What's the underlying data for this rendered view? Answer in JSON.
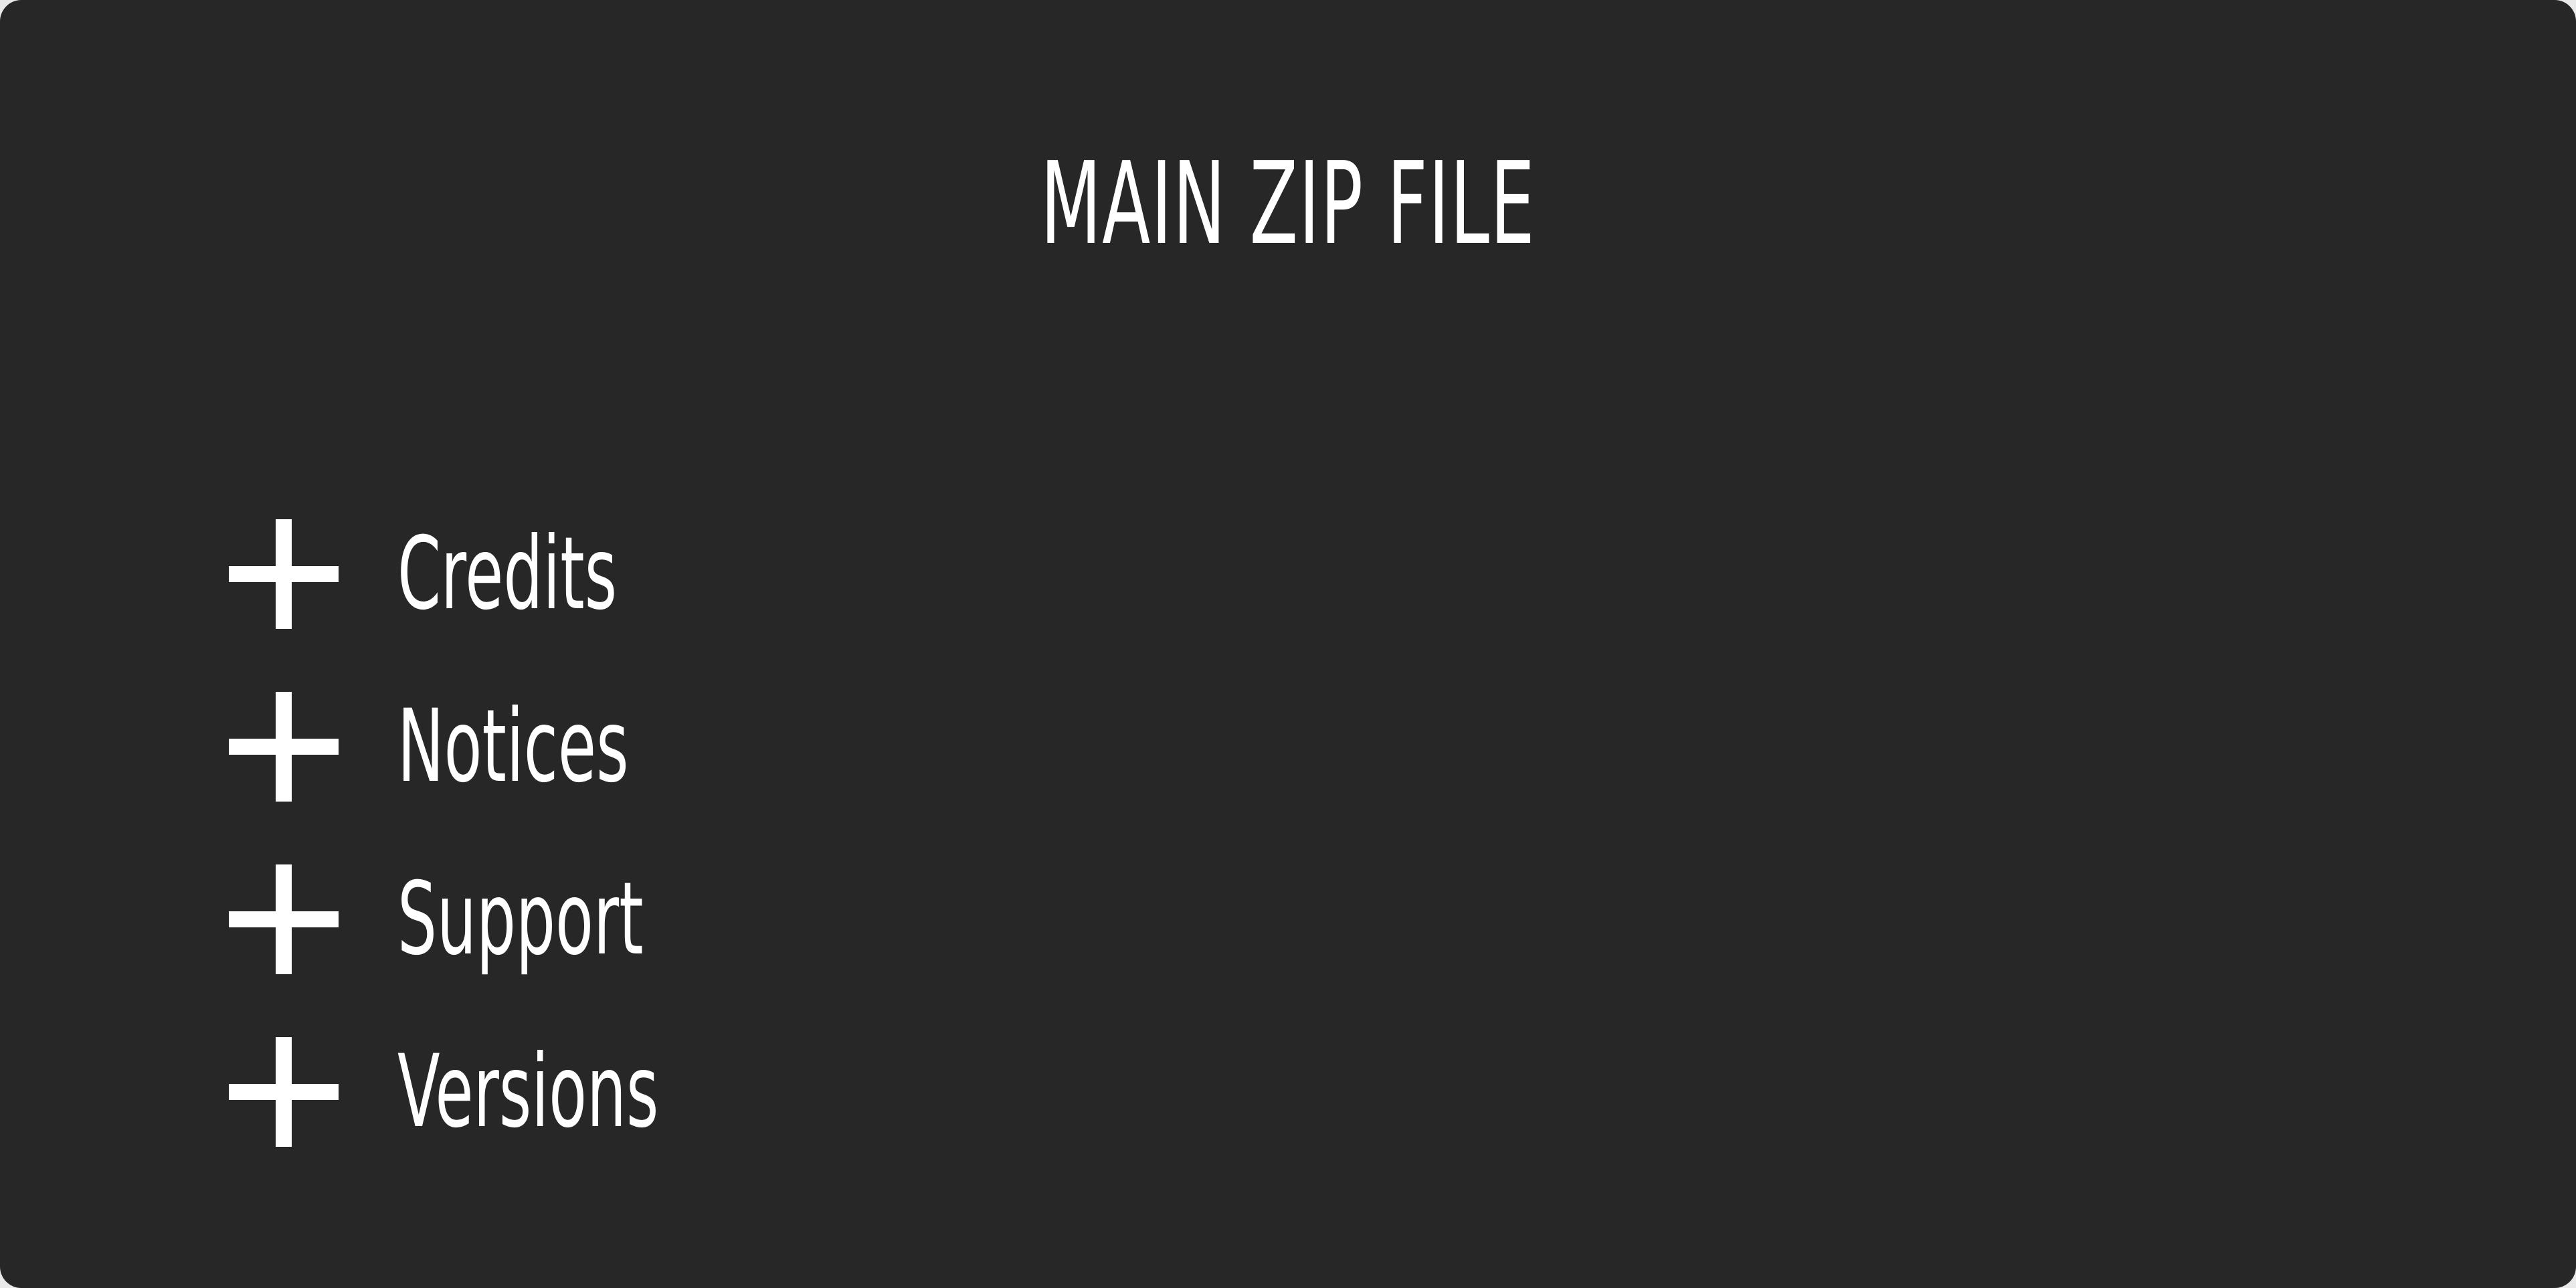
{
  "panel": {
    "title": "MAIN ZIP FILE",
    "items": [
      {
        "label": "Credits",
        "icon": "plus-icon"
      },
      {
        "label": "Notices",
        "icon": "plus-icon"
      },
      {
        "label": "Support",
        "icon": "plus-icon"
      },
      {
        "label": "Versions",
        "icon": "plus-icon"
      }
    ]
  },
  "colors": {
    "panel_background": "#272727",
    "text": "#ffffff"
  }
}
